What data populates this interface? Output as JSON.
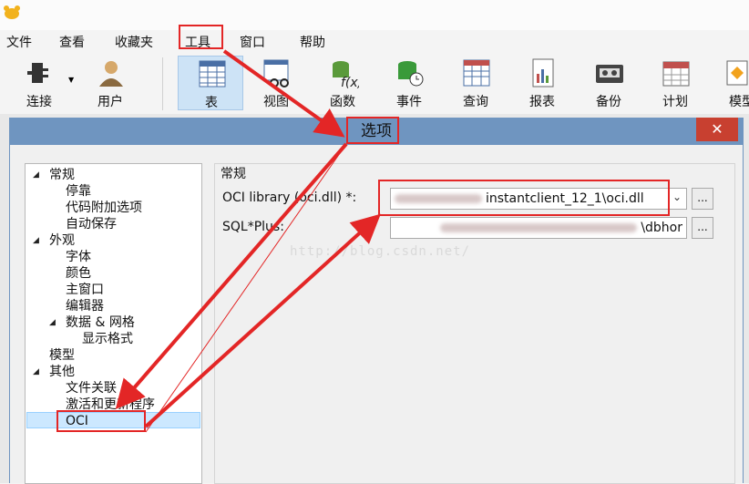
{
  "app": {
    "menu": [
      "文件",
      "查看",
      "收藏夹",
      "工具",
      "窗口",
      "帮助"
    ],
    "toolbar": [
      {
        "label": "连接",
        "icon": "plug-icon"
      },
      {
        "label": "用户",
        "icon": "user-icon"
      },
      {
        "label": "表",
        "icon": "table-icon"
      },
      {
        "label": "视图",
        "icon": "view-icon"
      },
      {
        "label": "函数",
        "icon": "function-icon"
      },
      {
        "label": "事件",
        "icon": "event-icon"
      },
      {
        "label": "查询",
        "icon": "query-icon"
      },
      {
        "label": "报表",
        "icon": "report-icon"
      },
      {
        "label": "备份",
        "icon": "backup-icon"
      },
      {
        "label": "计划",
        "icon": "schedule-icon"
      },
      {
        "label": "模型",
        "icon": "model-icon"
      }
    ]
  },
  "dialog": {
    "title": "选项",
    "close": "✕",
    "tree": [
      {
        "label": "常规",
        "level": 0,
        "expanded": true
      },
      {
        "label": "停靠",
        "level": 1
      },
      {
        "label": "代码附加选项",
        "level": 1
      },
      {
        "label": "自动保存",
        "level": 1
      },
      {
        "label": "外观",
        "level": 0,
        "expanded": true
      },
      {
        "label": "字体",
        "level": 1
      },
      {
        "label": "颜色",
        "level": 1
      },
      {
        "label": "主窗口",
        "level": 1
      },
      {
        "label": "编辑器",
        "level": 1
      },
      {
        "label": "数据 & 网格",
        "level": 1,
        "expanded": true
      },
      {
        "label": "显示格式",
        "level": 2
      },
      {
        "label": "模型",
        "level": 0
      },
      {
        "label": "其他",
        "level": 0,
        "expanded": true
      },
      {
        "label": "文件关联",
        "level": 1
      },
      {
        "label": "激活和更新程序",
        "level": 1
      },
      {
        "label": "OCI",
        "level": 1,
        "selected": true
      }
    ],
    "section": "常规",
    "oci_label": "OCI library (oci.dll) *:",
    "oci_value": "instantclient_12_1\\oci.dll",
    "sqlplus_label": "SQL*Plus:",
    "sqlplus_value": "\\dbhor",
    "browse": "..."
  },
  "watermark": "http://blog.csdn.net/",
  "colors": {
    "highlight": "#e32626",
    "title_bar": "#6f95c0",
    "selected": "#cce8ff"
  }
}
